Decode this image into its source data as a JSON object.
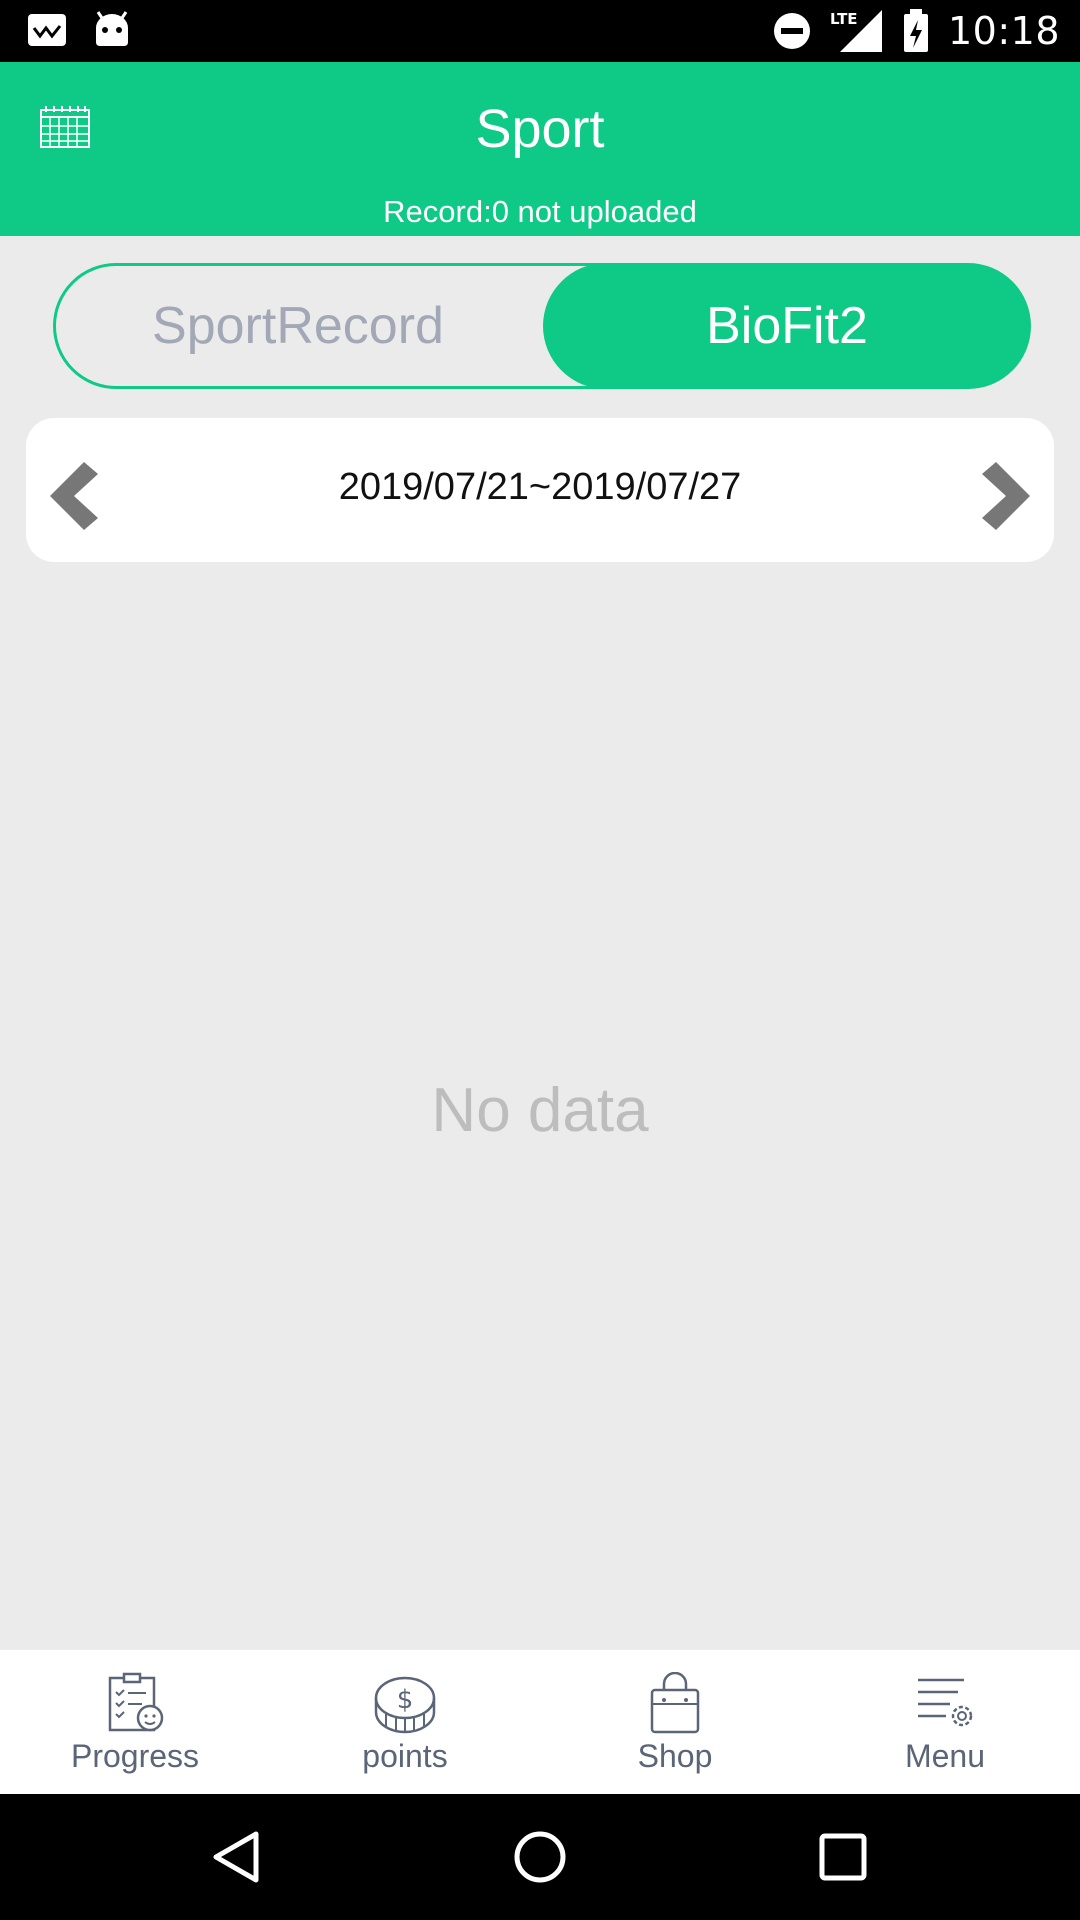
{
  "status_bar": {
    "time": "10:18",
    "network_label": "LTE"
  },
  "header": {
    "title": "Sport",
    "subtitle": "Record:0 not uploaded"
  },
  "tabs": [
    {
      "label": "SportRecord",
      "selected": false
    },
    {
      "label": "BioFit2",
      "selected": true
    }
  ],
  "date_range": "2019/07/21~2019/07/27",
  "empty_state": "No data",
  "bottom_nav": [
    {
      "label": "Progress",
      "icon": "clipboard-progress-icon"
    },
    {
      "label": "points",
      "icon": "coin-dollar-icon"
    },
    {
      "label": "Shop",
      "icon": "shopping-bag-icon"
    },
    {
      "label": "Menu",
      "icon": "menu-settings-icon"
    }
  ],
  "colors": {
    "accent": "#0fca86",
    "background": "#ebebeb",
    "tab_inactive_text": "#a3a8b6",
    "nav_text": "#5b6578",
    "empty_text": "#bdbdbd"
  }
}
